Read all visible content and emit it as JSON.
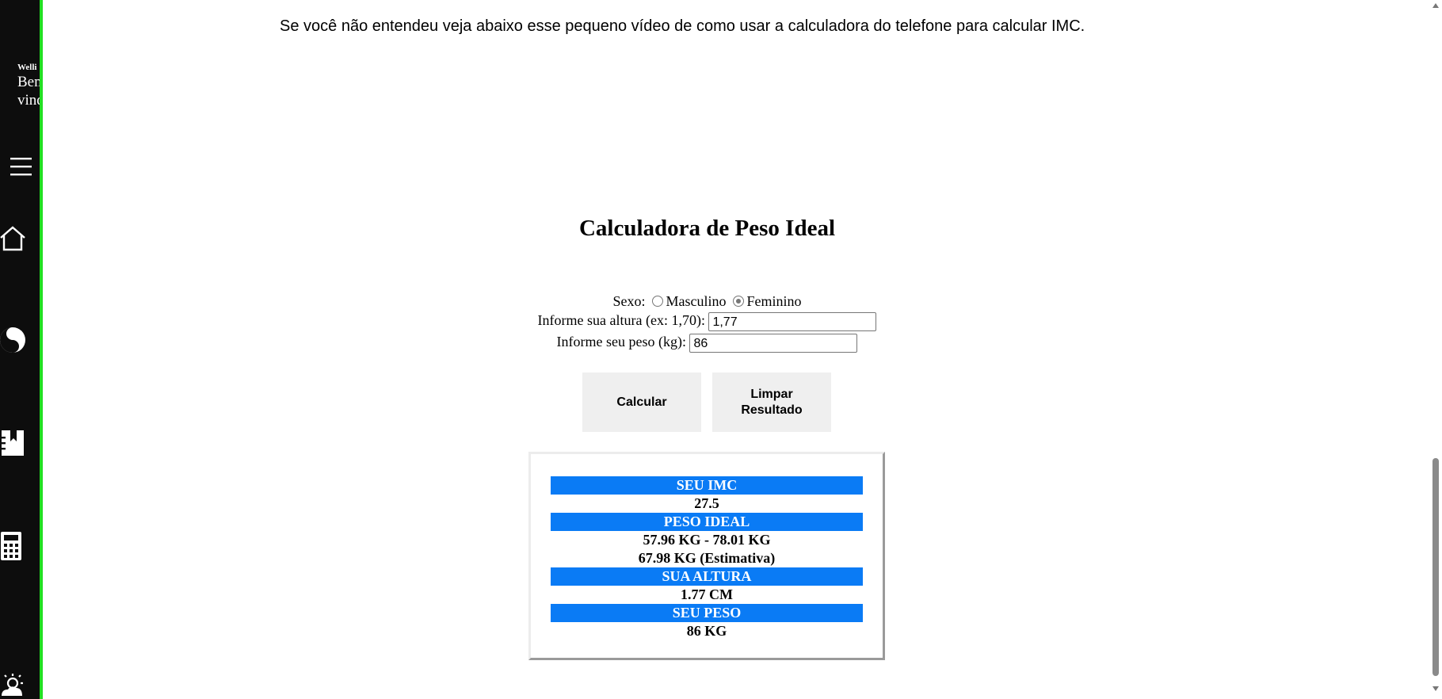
{
  "sidebar": {
    "user_name": "Welli",
    "welcome": "Bem vindo",
    "icons": [
      "menu-icon",
      "home-icon",
      "yin-yang-icon",
      "book-icon",
      "calculator-icon",
      "weather-icon"
    ],
    "accent_color": "#22e022"
  },
  "intro_text": "Se você não entendeu veja abaixo esse pequeno vídeo de como usar a calculadora do telefone para calcular IMC.",
  "calculator": {
    "title": "Calculadora de Peso Ideal",
    "sex_label": "Sexo:",
    "sex_options": [
      "Masculino",
      "Feminino"
    ],
    "sex_selected": "Feminino",
    "height_label": "Informe sua altura (ex: 1,70):",
    "height_value": "1,77",
    "weight_label": "Informe seu peso (kg):",
    "weight_value": "86",
    "calc_button": "Calcular",
    "clear_button": "Limpar Resultado"
  },
  "results": {
    "header_color": "#0a7bf5",
    "imc_label": "SEU IMC",
    "imc_value": "27.5",
    "ideal_label": "PESO IDEAL",
    "ideal_range": "57.96 KG - 78.01 KG",
    "ideal_estimate": "67.98 KG (Estimativa)",
    "height_label": "SUA ALTURA",
    "height_value": "1.77 CM",
    "weight_label": "SEU PESO",
    "weight_value": "86 KG"
  }
}
